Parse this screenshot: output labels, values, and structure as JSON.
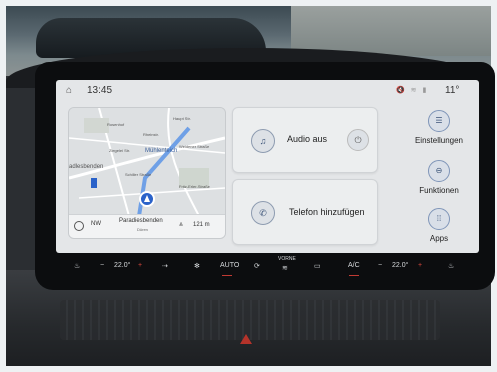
{
  "status_bar": {
    "time": "13:45",
    "temperature": "11°",
    "icons": [
      "home-icon",
      "mute-icon",
      "wifi-icon",
      "signal-icon"
    ]
  },
  "map": {
    "labels": [
      "Rosenhof",
      "Rheinstr.",
      "Haupt Str.",
      "Ziegelei Str.",
      "Mühlenteich",
      "Weidener Straße",
      "adlesbenden",
      "Fritz-Erler-Straße",
      "Schiller Straße"
    ],
    "heading": "NW",
    "destination": "Paradiesbenden",
    "destination_sub": "Düren",
    "distance": "121 m"
  },
  "cards": {
    "audio_label": "Audio aus",
    "phone_label": "Telefon hinzufügen"
  },
  "shortcuts": {
    "settings": "Einstellungen",
    "functions": "Funktionen",
    "apps": "Apps"
  },
  "climate": {
    "left_temp": "22.0°",
    "right_temp": "22.0°",
    "auto_label": "AUTO",
    "ac_label": "A/C",
    "front_label": "VORNE",
    "minus": "−",
    "plus": "+"
  },
  "colors": {
    "accent_blue": "#3b5378",
    "climate_red": "#d9473d",
    "screen_bg": "#e4e6e8"
  }
}
